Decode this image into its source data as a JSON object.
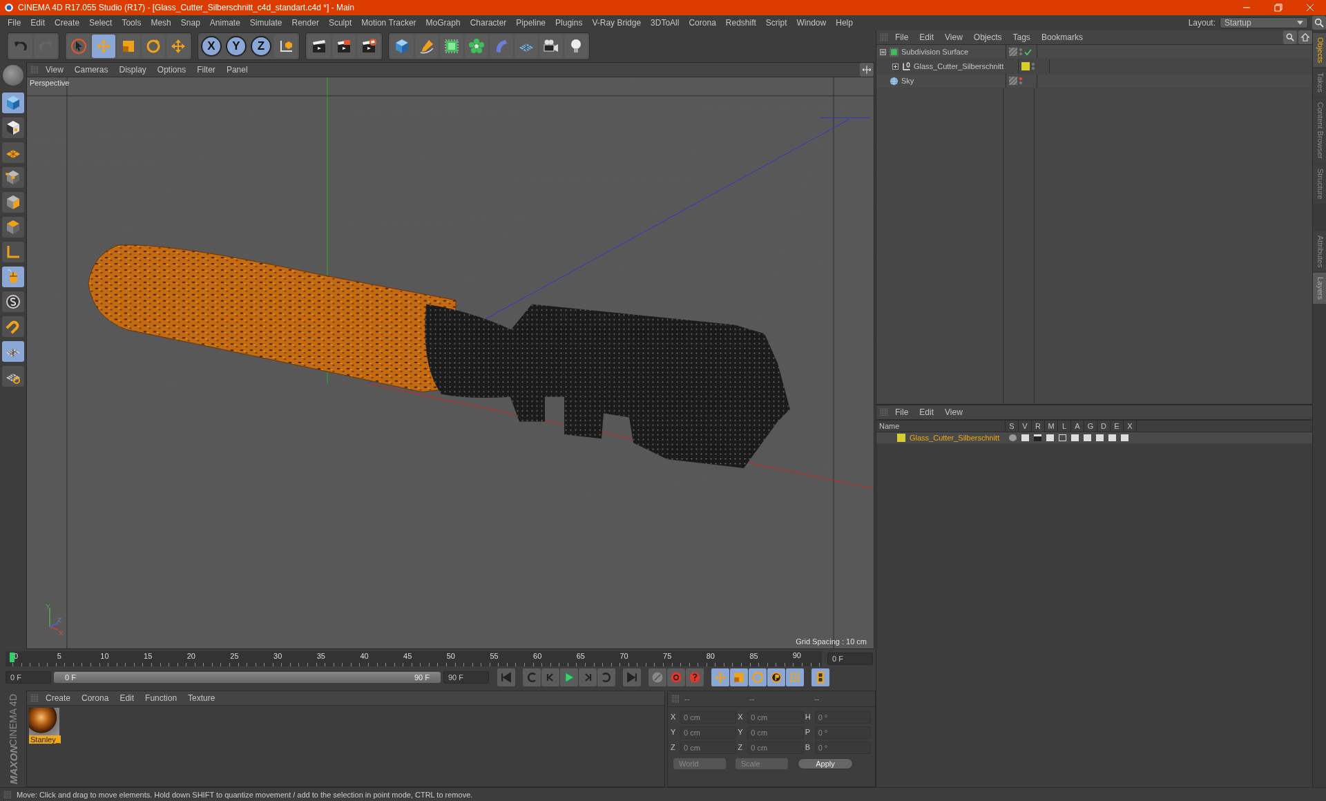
{
  "window": {
    "title": "CINEMA 4D R17.055 Studio (R17) - [Glass_Cutter_Silberschnitt_c4d_standart.c4d *] - Main"
  },
  "menu": [
    "File",
    "Edit",
    "Create",
    "Select",
    "Tools",
    "Mesh",
    "Snap",
    "Animate",
    "Simulate",
    "Render",
    "Sculpt",
    "Motion Tracker",
    "MoGraph",
    "Character",
    "Pipeline",
    "Plugins",
    "V-Ray Bridge",
    "3DToAll",
    "Corona",
    "Redshift",
    "Script",
    "Window",
    "Help"
  ],
  "layout": {
    "label": "Layout:",
    "value": "Startup"
  },
  "toolbar": {
    "tools": [
      {
        "kind": "select",
        "selected": false
      },
      {
        "kind": "move",
        "selected": true
      },
      {
        "kind": "scale",
        "selected": false
      },
      {
        "kind": "rotate",
        "selected": false
      },
      {
        "kind": "last",
        "selected": false
      }
    ],
    "axes": [
      {
        "label": "X",
        "selected": true
      },
      {
        "label": "Y",
        "selected": true
      },
      {
        "label": "Z",
        "selected": true
      }
    ]
  },
  "left_tools": [
    {
      "kind": "model",
      "selected": true
    },
    {
      "kind": "texture",
      "selected": false
    },
    {
      "kind": "workplane",
      "selected": false
    },
    {
      "kind": "points",
      "selected": false
    },
    {
      "kind": "edges",
      "selected": false
    },
    {
      "kind": "polygons",
      "selected": false
    },
    {
      "kind": "axis",
      "selected": false
    },
    {
      "kind": "tweak",
      "selected": true
    },
    {
      "kind": "snap",
      "selected": false
    },
    {
      "kind": "magnet",
      "selected": false
    },
    {
      "kind": "lockplane",
      "selected": true
    },
    {
      "kind": "gridplane",
      "selected": false
    }
  ],
  "viewport": {
    "menu": [
      "View",
      "Cameras",
      "Display",
      "Options",
      "Filter",
      "Panel"
    ],
    "camera": "Perspective",
    "grid_spacing": "Grid Spacing : 10 cm",
    "gizmo": [
      "Y",
      "Z",
      "X"
    ]
  },
  "objects_panel": {
    "menu": [
      "File",
      "Edit",
      "View",
      "Objects",
      "Tags",
      "Bookmarks"
    ],
    "objects": [
      {
        "name": "Subdivision Surface",
        "kind": "subdivision",
        "expanded": true,
        "editor_visible": true,
        "enabled": true,
        "children": [
          {
            "name": "Glass_Cutter_Silberschnitt",
            "kind": "null",
            "expanded": false,
            "editor_visible": true,
            "color": "#d6cf2a"
          }
        ]
      },
      {
        "name": "Sky",
        "kind": "sky",
        "editor_visible": false
      }
    ]
  },
  "layers_panel": {
    "menu": [
      "File",
      "Edit",
      "View"
    ],
    "columns": [
      "Name",
      "S",
      "V",
      "R",
      "M",
      "L",
      "A",
      "G",
      "D",
      "E",
      "X"
    ],
    "layers": [
      {
        "name": "Glass_Cutter_Silberschnitt",
        "color": "#d6cf2a",
        "selected": true
      }
    ]
  },
  "side_tabs": [
    {
      "label": "Objects",
      "selected": true
    },
    {
      "label": "Takes",
      "selected": false
    },
    {
      "label": "Content Browser",
      "selected": false
    },
    {
      "label": "Structure",
      "selected": false
    }
  ],
  "side_tabs_lower": [
    {
      "label": "Attributes",
      "selected": false
    },
    {
      "label": "Layers",
      "selected": true
    }
  ],
  "timeline": {
    "preview_range": {
      "level": 1
    },
    "ruler": [
      "0",
      "5",
      "10",
      "15",
      "20",
      "25",
      "30",
      "35",
      "40",
      "45",
      "50",
      "55",
      "60",
      "65",
      "70",
      "75",
      "80",
      "85",
      "90"
    ],
    "playhead": {
      "level": 0
    },
    "current_frame": "0 F",
    "start": "0 F",
    "range_start": "0 F",
    "range_end": "90 F",
    "end": "90 F",
    "key_tracks": [
      {
        "kind": "position",
        "selected": true
      },
      {
        "kind": "scale",
        "selected": true
      },
      {
        "kind": "rotation",
        "selected": true
      },
      {
        "kind": "parameter",
        "selected": true
      },
      {
        "kind": "pla",
        "selected": true
      }
    ]
  },
  "materials": {
    "menu": [
      "Create",
      "Corona",
      "Edit",
      "Function",
      "Texture"
    ],
    "items": [
      {
        "name": "Stanley_",
        "selected": true
      }
    ]
  },
  "coordinates": {
    "headers": [
      "--",
      "--",
      "--"
    ],
    "disabled": true,
    "rows": [
      [
        {
          "axis": "X",
          "value": "0 cm"
        },
        {
          "axis": "X",
          "value": "0 cm"
        },
        {
          "axis": "H",
          "value": "0 °"
        }
      ],
      [
        {
          "axis": "Y",
          "value": "0 cm"
        },
        {
          "axis": "Y",
          "value": "0 cm"
        },
        {
          "axis": "P",
          "value": "0 °"
        }
      ],
      [
        {
          "axis": "Z",
          "value": "0 cm"
        },
        {
          "axis": "Z",
          "value": "0 cm"
        },
        {
          "axis": "B",
          "value": "0 °"
        }
      ]
    ],
    "mode": "World",
    "scale": "Scale",
    "apply": "Apply"
  },
  "logo": {
    "brand": "MAXON",
    "product": "CINEMA 4D"
  },
  "status_bar": "Move: Click and drag to move elements. Hold down SHIFT to quantize movement / add to the selection in point mode, CTRL to remove."
}
